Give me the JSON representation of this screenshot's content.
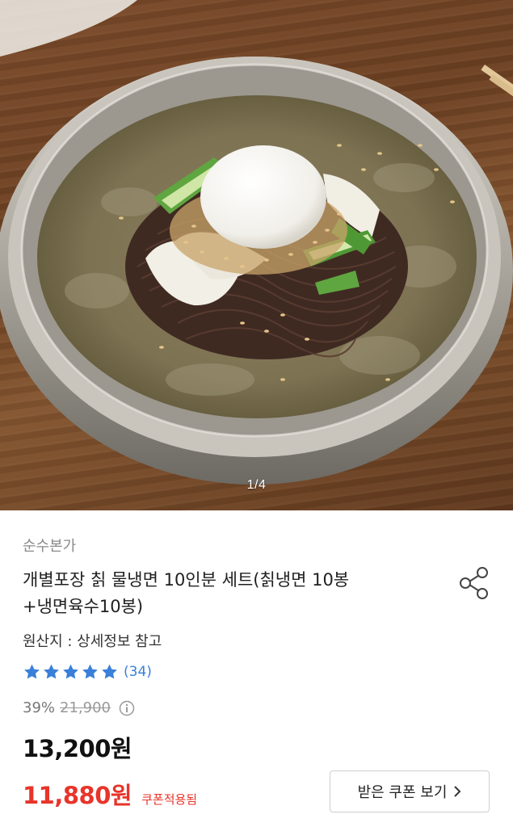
{
  "gallery": {
    "image_alt": "물냉면 product photo",
    "page_indicator": "1/4"
  },
  "product": {
    "brand": "순수본가",
    "title_line1": "개별포장 칡 물냉면 10인분 세트(칡냉면 10봉",
    "title_line2": "+냉면육수10봉)",
    "origin": "원산지 : 상세정보 참고",
    "rating_stars": 5,
    "review_count": "(34)",
    "discount_rate": "39%",
    "original_price": "21,900",
    "price": "13,200원",
    "coupon_price": "11,880원",
    "coupon_tag": "쿠폰적용됨",
    "coupon_button_label": "받은 쿠폰 보기"
  },
  "colors": {
    "accent_red": "#e8342a",
    "star_blue": "#3a7fd9",
    "brand_gray": "#8a8a8a"
  },
  "icons": {
    "share": "share-icon",
    "info": "info-icon",
    "chevron": "chevron-right-icon",
    "star": "star-icon"
  }
}
